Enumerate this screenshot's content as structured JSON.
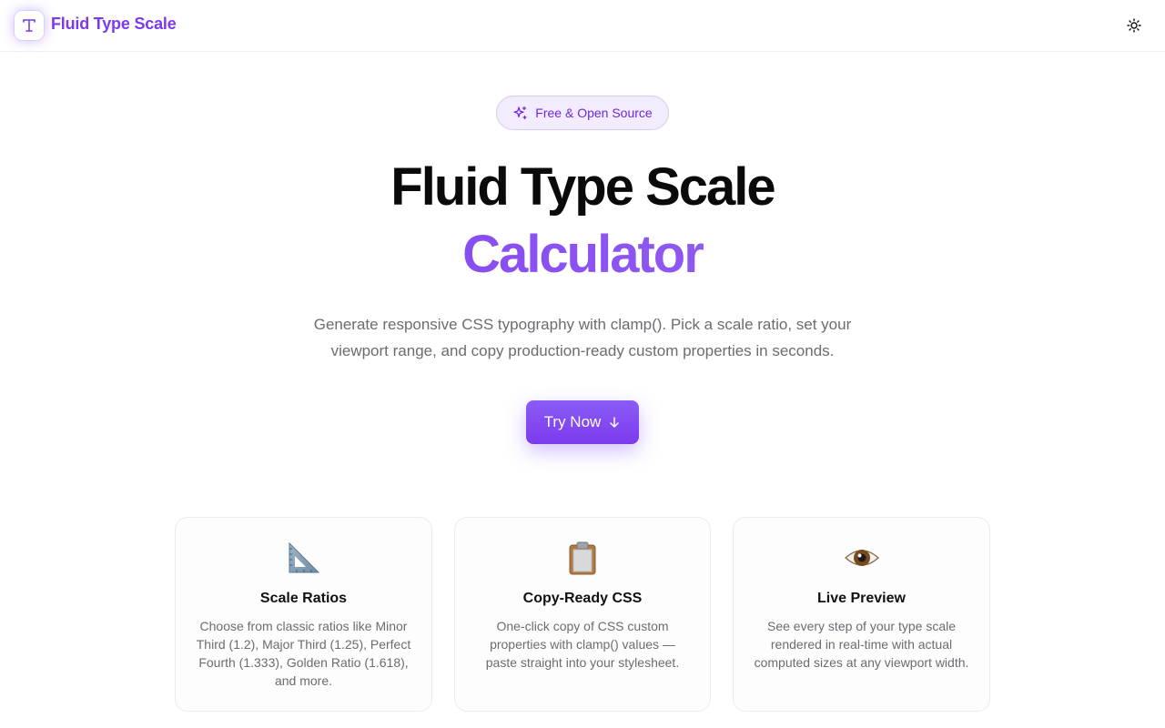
{
  "header": {
    "logo_icon": "type-letter-t-icon",
    "brand_name": "Fluid Type Scale",
    "theme_toggle_icon": "sun-icon"
  },
  "hero": {
    "badge_icon": "sparkles-icon",
    "badge_text": "Free & Open Source",
    "title_line1": "Fluid Type Scale",
    "title_line2": "Calculator",
    "subtitle_line1": "Generate responsive CSS typography with clamp(). Pick a scale ratio, set your",
    "subtitle_line2": "viewport range, and copy production-ready custom properties in seconds.",
    "cta_label": "Try Now",
    "cta_icon": "arrow-down-icon"
  },
  "features": [
    {
      "icon": "triangular-ruler-icon",
      "title": "Scale Ratios",
      "description": "Choose from classic ratios like Minor Third (1.2), Major Third (1.25), Perfect Fourth (1.333), Golden Ratio (1.618), and more."
    },
    {
      "icon": "clipboard-icon",
      "title": "Copy-Ready CSS",
      "description": "One-click copy of CSS custom properties with clamp() values — paste straight into your stylesheet."
    },
    {
      "icon": "eye-icon",
      "title": "Live Preview",
      "description": "See every step of your type scale rendered in real-time with actual computed sizes at any viewport width."
    }
  ],
  "colors": {
    "accent": "#7c3aed",
    "accent_light": "#8b5cf6",
    "badge_bg": "#f3ecfe",
    "muted_text": "#6b6b73"
  }
}
